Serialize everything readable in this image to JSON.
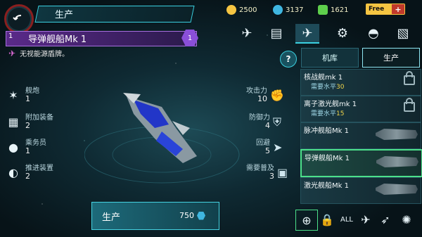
{
  "header": {
    "title": "生产",
    "resources": [
      {
        "icon": "gold-coin-icon",
        "value": "2500",
        "color": "#f5c542"
      },
      {
        "icon": "crystal-icon",
        "value": "3137",
        "color": "#3fb6e0"
      },
      {
        "icon": "fuel-icon",
        "value": "1621",
        "color": "#5ecf4c"
      }
    ],
    "free_label": "Free",
    "plus_label": "+"
  },
  "ship": {
    "level_left": "1",
    "name": "导弹舰船Mk 1",
    "level_badge": "1",
    "perk": "无视能源盾牌。"
  },
  "stats_left": [
    {
      "label": "舰炮",
      "value": "1",
      "icon": "cannon-icon"
    },
    {
      "label": "附加装备",
      "value": "2",
      "icon": "equipment-icon"
    },
    {
      "label": "乘务员",
      "value": "1",
      "icon": "crew-icon"
    },
    {
      "label": "推进装置",
      "value": "2",
      "icon": "thruster-icon"
    }
  ],
  "stats_right": [
    {
      "label": "攻击力",
      "value": "10",
      "icon": "attack-icon"
    },
    {
      "label": "防御力",
      "value": "4",
      "icon": "defense-icon"
    },
    {
      "label": "回避",
      "value": "5",
      "icon": "evade-icon"
    },
    {
      "label": "需要普及",
      "value": "3",
      "icon": "cargo-icon"
    }
  ],
  "categories": [
    {
      "name": "fighter-category-icon",
      "active": false
    },
    {
      "name": "map-category-icon",
      "active": false
    },
    {
      "name": "missile-ship-category-icon",
      "active": true
    },
    {
      "name": "robot-category-icon",
      "active": false
    },
    {
      "name": "helmet-category-icon",
      "active": false
    },
    {
      "name": "clipboard-category-icon",
      "active": false
    }
  ],
  "tabs": {
    "hangar": "机库",
    "production": "生产"
  },
  "help_label": "?",
  "ship_list": [
    {
      "name": "核战舰mk 1",
      "req_label": "需要水平",
      "req_value": "30",
      "locked": true
    },
    {
      "name": "离子激光舰mk 1",
      "req_label": "需要水平",
      "req_value": "15",
      "locked": true
    },
    {
      "name": "脉冲舰船Mk 1",
      "locked": false
    },
    {
      "name": "导弹舰船Mk 1",
      "locked": false,
      "selected": true
    },
    {
      "name": "激光舰船Mk 1",
      "locked": false
    }
  ],
  "production": {
    "label": "生产",
    "cost": "750"
  },
  "bottom_bar": {
    "all_label": "ALL"
  }
}
